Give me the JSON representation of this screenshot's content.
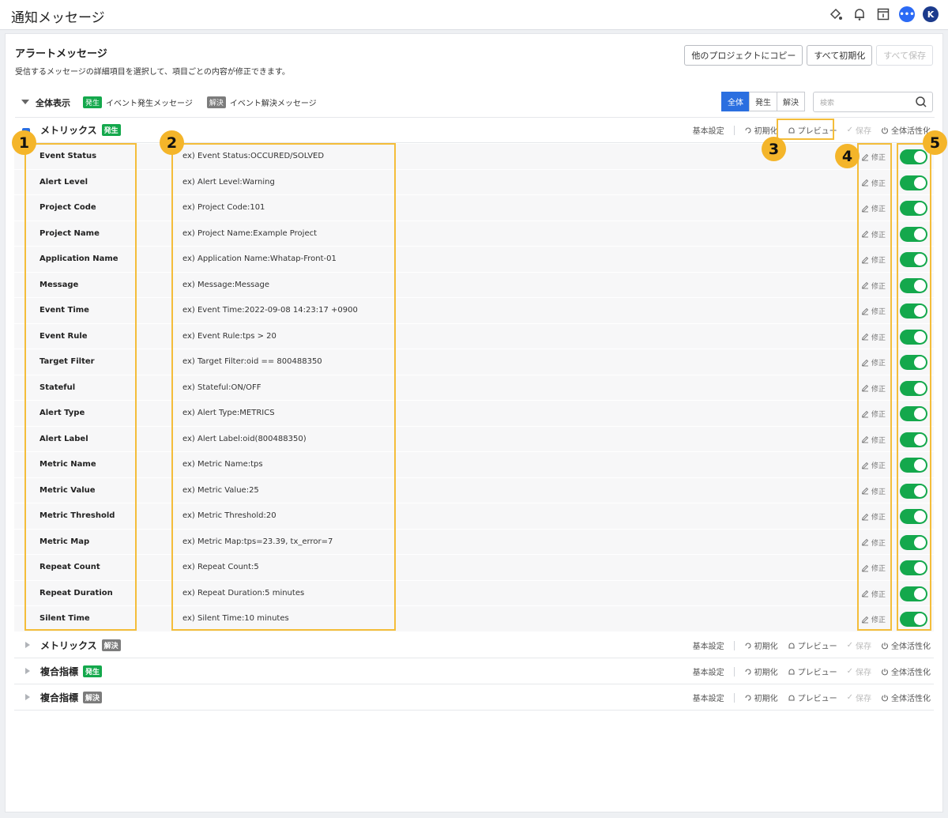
{
  "topbar": {
    "title": "通知メッセージ",
    "avatar": "K"
  },
  "header": {
    "title": "アラートメッセージ",
    "subtitle": "受信するメッセージの詳細項目を選択して、項目ごとの内容が修正できます。",
    "buttons": [
      "他のプロジェクトにコピー",
      "すべて初期化",
      "すべて保存"
    ]
  },
  "filter": {
    "all_show": "全体表示",
    "legend_occur_badge": "発生",
    "legend_occur_text": "イベント発生メッセージ",
    "legend_solve_badge": "解決",
    "legend_solve_text": "イベント解決メッセージ",
    "segments": [
      "全体",
      "発生",
      "解決"
    ],
    "search_placeholder": "検索"
  },
  "tools": {
    "basic": "基本設定",
    "reset": "初期化",
    "preview": "プレビュー",
    "save": "保存",
    "activate_all": "全体活性化"
  },
  "sections": [
    {
      "name": "メトリックス",
      "badge": "発生"
    },
    {
      "name": "メトリックス",
      "badge": "解決"
    },
    {
      "name": "複合指標",
      "badge": "発生"
    },
    {
      "name": "複合指標",
      "badge": "解決"
    }
  ],
  "edit_label": "修正",
  "rows": [
    {
      "key": "Event Status",
      "value": "ex) Event Status:OCCURED/SOLVED"
    },
    {
      "key": "Alert Level",
      "value": "ex) Alert Level:Warning"
    },
    {
      "key": "Project Code",
      "value": "ex) Project Code:101"
    },
    {
      "key": "Project Name",
      "value": "ex) Project Name:Example Project"
    },
    {
      "key": "Application Name",
      "value": "ex) Application Name:Whatap-Front-01"
    },
    {
      "key": "Message",
      "value": "ex) Message:Message"
    },
    {
      "key": "Event Time",
      "value": "ex) Event Time:2022-09-08 14:23:17 +0900"
    },
    {
      "key": "Event Rule",
      "value": "ex) Event Rule:tps > 20"
    },
    {
      "key": "Target Filter",
      "value": "ex) Target Filter:oid == 800488350"
    },
    {
      "key": "Stateful",
      "value": "ex) Stateful:ON/OFF"
    },
    {
      "key": "Alert Type",
      "value": "ex) Alert Type:METRICS"
    },
    {
      "key": "Alert Label",
      "value": "ex) Alert Label:oid(800488350)"
    },
    {
      "key": "Metric Name",
      "value": "ex) Metric Name:tps"
    },
    {
      "key": "Metric Value",
      "value": "ex) Metric Value:25"
    },
    {
      "key": "Metric Threshold",
      "value": "ex) Metric Threshold:20"
    },
    {
      "key": "Metric Map",
      "value": "ex) Metric Map:tps=23.39, tx_error=7"
    },
    {
      "key": "Repeat Count",
      "value": "ex) Repeat Count:5"
    },
    {
      "key": "Repeat Duration",
      "value": "ex) Repeat Duration:5 minutes"
    },
    {
      "key": "Silent Time",
      "value": "ex) Silent Time:10 minutes"
    }
  ],
  "callouts": [
    "1",
    "2",
    "3",
    "4",
    "5"
  ],
  "colors": {
    "accent": "#2b6fe0",
    "toggle_on": "#14a84c",
    "highlight": "#f4bd3a",
    "occur_badge": "#14a84c",
    "solve_badge": "#7c7c7c"
  }
}
